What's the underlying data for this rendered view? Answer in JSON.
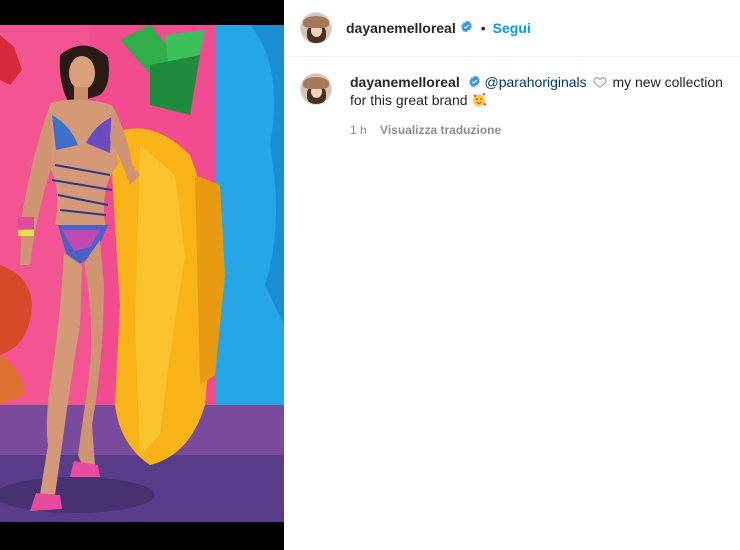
{
  "post": {
    "username": "dayanemelloreal",
    "follow_label": "Segui",
    "separator": "•"
  },
  "caption": {
    "username": "dayanemelloreal",
    "mention": "@parahoriginals",
    "text_after_heart": " my new collection for this great brand ",
    "emoji": "smiling-face-with-hearts",
    "time": "1 h",
    "translate_label": "Visualizza traduzione"
  },
  "colors": {
    "link_blue": "#0095f6",
    "mention_blue": "#00376b",
    "muted": "#8e8e8e",
    "verified_blue": "#3897f0"
  },
  "icons": [
    "verified-badge-icon",
    "heart-outline-icon"
  ]
}
